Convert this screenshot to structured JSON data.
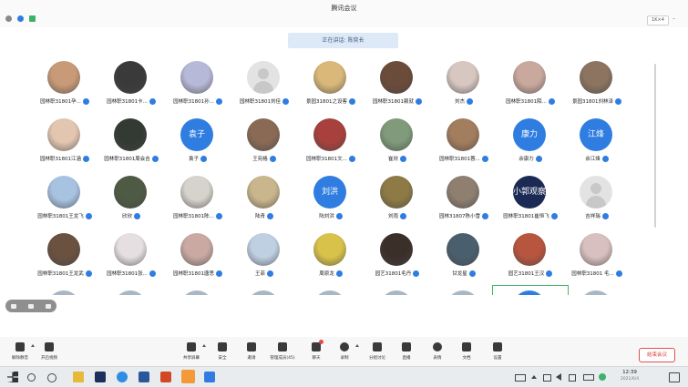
{
  "window": {
    "title": "腾讯会议",
    "view_label": "1K×4"
  },
  "banner": {
    "text": "正在讲话: 陈奕长"
  },
  "participants": [
    {
      "name": "园林职31801孕...",
      "avatar": "photo",
      "color": "#c89a78"
    },
    {
      "name": "园林职31801卡...",
      "avatar": "photo",
      "color": "#3a3a3a"
    },
    {
      "name": "园林职31801孙...",
      "avatar": "photo",
      "color": "#b7b9d8"
    },
    {
      "name": "园林职31801刘佳",
      "avatar": "default",
      "color": "#e3e3e3"
    },
    {
      "name": "景园31801之设客",
      "avatar": "photo",
      "color": "#d9b879"
    },
    {
      "name": "园林职31801赖就",
      "avatar": "photo",
      "color": "#6b4b3a"
    },
    {
      "name": "刘杰",
      "avatar": "photo",
      "color": "#d7c7c0"
    },
    {
      "name": "园林职31801陌...",
      "avatar": "photo",
      "color": "#c9a89e"
    },
    {
      "name": "景园31801刘林泽",
      "avatar": "photo",
      "color": "#8c7460"
    },
    {
      "name": "园林职31801江涵",
      "avatar": "photo",
      "color": "#e3c6b0"
    },
    {
      "name": "园林职31801周会吉",
      "avatar": "photo",
      "color": "#333a33"
    },
    {
      "name": "袁子",
      "avatar": "text",
      "text": "袁子",
      "color": "#2f7de1"
    },
    {
      "name": "王宛格",
      "avatar": "photo",
      "color": "#8a6a55"
    },
    {
      "name": "园林职31801文...",
      "avatar": "photo",
      "color": "#a8413d"
    },
    {
      "name": "崔欣",
      "avatar": "photo",
      "color": "#7f9b7a"
    },
    {
      "name": "园林职31801蓉...",
      "avatar": "photo",
      "color": "#a27d5e"
    },
    {
      "name": "余康力",
      "avatar": "text",
      "text": "康力",
      "color": "#2f7de1"
    },
    {
      "name": "余江烽",
      "avatar": "text",
      "text": "江烽",
      "color": "#2f7de1"
    },
    {
      "name": "园林职31801王龙飞",
      "avatar": "photo",
      "color": "#a8c3e2"
    },
    {
      "name": "欣欣",
      "avatar": "photo",
      "color": "#4e5a44"
    },
    {
      "name": "园林职31801陈...",
      "avatar": "photo",
      "color": "#d6d2cc"
    },
    {
      "name": "陆青",
      "avatar": "photo",
      "color": "#c9b68c"
    },
    {
      "name": "陆刘洪",
      "avatar": "text",
      "text": "刘洪",
      "color": "#2f7de1"
    },
    {
      "name": "刘雨",
      "avatar": "photo",
      "color": "#8d7a45"
    },
    {
      "name": "园林31807陈小雪",
      "avatar": "photo",
      "color": "#8e7f70"
    },
    {
      "name": "园林职31801崔恒飞",
      "avatar": "text",
      "text": "小郭观察",
      "color": "#1a2a55"
    },
    {
      "name": "吉祥瑞",
      "avatar": "default",
      "color": "#e3e3e3"
    },
    {
      "name": "园林职31801王龙武",
      "avatar": "photo",
      "color": "#6a5140"
    },
    {
      "name": "园林职31801张...",
      "avatar": "photo",
      "color": "#e6dfe2"
    },
    {
      "name": "园林职31801唐思",
      "avatar": "photo",
      "color": "#c9a9a2"
    },
    {
      "name": "王菲",
      "avatar": "photo",
      "color": "#bfd0e2"
    },
    {
      "name": "周原龙",
      "avatar": "photo",
      "color": "#d9c24a"
    },
    {
      "name": "园艺31801毛丹",
      "avatar": "photo",
      "color": "#3b2f2a"
    },
    {
      "name": "甘龙星",
      "avatar": "photo",
      "color": "#4a5f6e"
    },
    {
      "name": "园艺31801王汉",
      "avatar": "photo",
      "color": "#b8553f"
    },
    {
      "name": "园林职31801 毛...",
      "avatar": "photo",
      "color": "#d8c0c0"
    }
  ],
  "toolbar": {
    "items": [
      {
        "label": "解除静音",
        "icon": "mic-icon",
        "has_caret": true
      },
      {
        "label": "开启视频",
        "icon": "camera-off-icon",
        "has_caret": false
      },
      {
        "label": "共享屏幕",
        "icon": "screen-share-icon",
        "has_caret": true
      },
      {
        "label": "安全",
        "icon": "shield-icon",
        "has_caret": false
      },
      {
        "label": "邀请",
        "icon": "add-user-icon",
        "has_caret": false
      },
      {
        "label": "管理成员(45)",
        "icon": "members-icon",
        "has_caret": false
      },
      {
        "label": "聊天",
        "icon": "chat-icon",
        "has_caret": false
      },
      {
        "label": "录制",
        "icon": "record-icon",
        "has_caret": true
      },
      {
        "label": "分组讨论",
        "icon": "groups-icon",
        "has_caret": false
      },
      {
        "label": "直播",
        "icon": "live-icon",
        "has_caret": false
      },
      {
        "label": "表情",
        "icon": "emoji-icon",
        "has_caret": false
      },
      {
        "label": "文档",
        "icon": "document-icon",
        "has_caret": false
      },
      {
        "label": "设置",
        "icon": "gear-icon",
        "has_caret": false
      }
    ],
    "end_meeting": "结束会议"
  },
  "taskbar": {
    "time": "12:39",
    "date": "2021/6/4"
  },
  "colors": {
    "accent": "#2f7de1",
    "end": "#e03b3b"
  }
}
